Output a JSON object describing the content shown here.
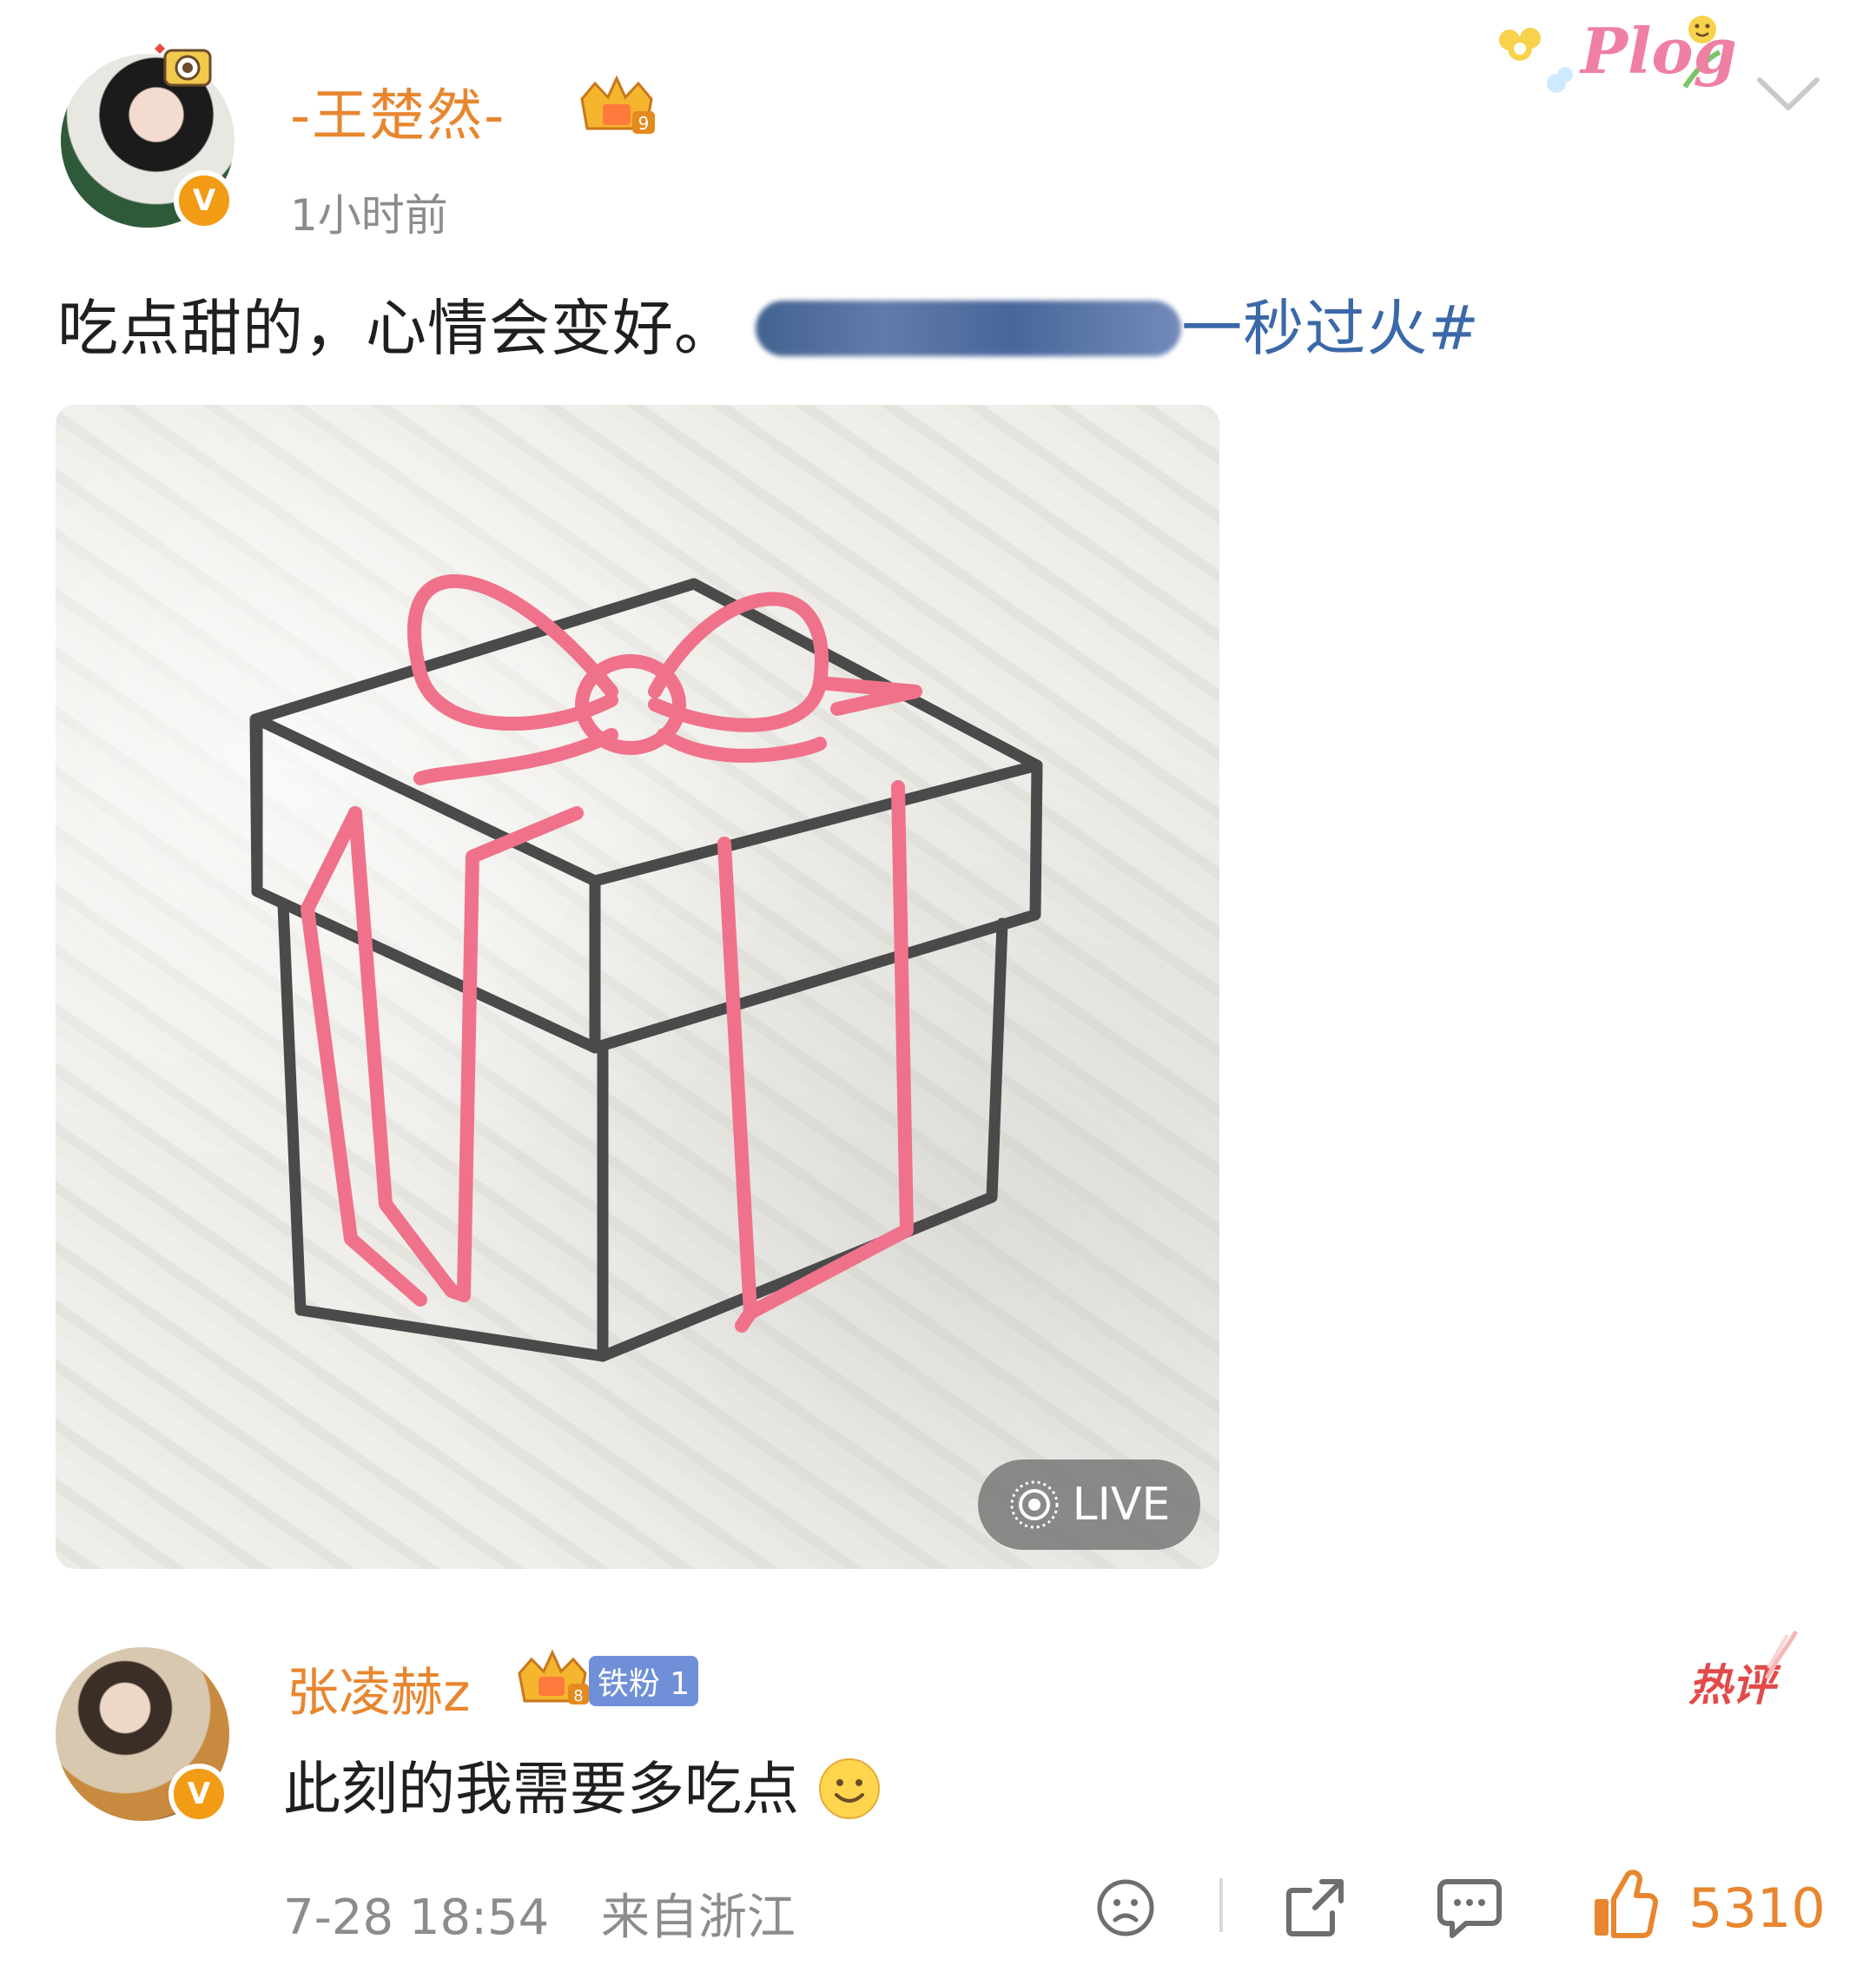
{
  "post": {
    "author": "-王楚然-",
    "time_ago": "1小时前",
    "text": "吃点甜的，心情会变好。",
    "topic_suffix": "一秒过火#",
    "live_label": "LIVE",
    "sticker_text": "Plog"
  },
  "comment": {
    "author": "张凌赫z",
    "fan_badge": "铁粉 1",
    "hot_label": "热评",
    "text": "此刻的我需要多吃点",
    "date": "7-28 18:54",
    "location": "来自浙江",
    "likes": "5310"
  },
  "icons": {
    "more": "chevron-down-icon",
    "verified": "verified-v-icon",
    "dislike": "sad-face-icon",
    "share": "share-icon",
    "reply": "comment-icon",
    "like": "thumbs-up-icon"
  },
  "colors": {
    "username": "#e8862f",
    "topic": "#3b68a8",
    "hot": "#e24a4a",
    "ribbon": "#f0728a"
  }
}
